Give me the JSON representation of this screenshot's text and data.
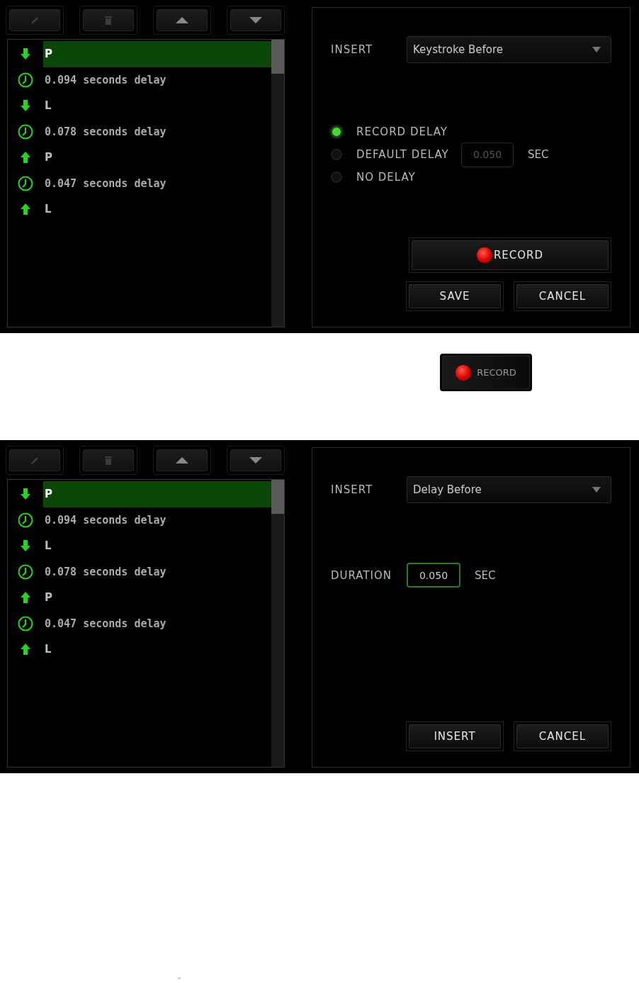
{
  "screens": [
    {
      "toolbar": [
        {
          "kind": "edit",
          "disabled": true
        },
        {
          "kind": "delete",
          "disabled": true
        },
        {
          "kind": "up",
          "disabled": false
        },
        {
          "kind": "down",
          "disabled": false
        }
      ],
      "macro_list": [
        {
          "kind": "key_down",
          "label": "P",
          "selected": true
        },
        {
          "kind": "delay",
          "label": "0.094 seconds delay",
          "selected": false
        },
        {
          "kind": "key_down",
          "label": "L",
          "selected": false
        },
        {
          "kind": "delay",
          "label": "0.078 seconds delay",
          "selected": false
        },
        {
          "kind": "key_up",
          "label": "P",
          "selected": false
        },
        {
          "kind": "delay",
          "label": "0.047 seconds delay",
          "selected": false
        },
        {
          "kind": "key_up",
          "label": "L",
          "selected": false
        }
      ],
      "panel": {
        "insert_label": "INSERT",
        "insert_value": "Keystroke Before",
        "delay_options": [
          {
            "label": "RECORD DELAY",
            "selected": true
          },
          {
            "label": "DEFAULT DELAY",
            "selected": false,
            "value": "0.050",
            "unit": "SEC"
          },
          {
            "label": "NO DELAY",
            "selected": false
          }
        ],
        "record_button": "RECORD",
        "buttons": [
          "SAVE",
          "CANCEL"
        ]
      }
    },
    {
      "toolbar": [
        {
          "kind": "edit",
          "disabled": true
        },
        {
          "kind": "delete",
          "disabled": true
        },
        {
          "kind": "up",
          "disabled": false
        },
        {
          "kind": "down",
          "disabled": false
        }
      ],
      "macro_list": [
        {
          "kind": "key_down",
          "label": "P",
          "selected": true
        },
        {
          "kind": "delay",
          "label": "0.094 seconds delay",
          "selected": false
        },
        {
          "kind": "key_down",
          "label": "L",
          "selected": false
        },
        {
          "kind": "delay",
          "label": "0.078 seconds delay",
          "selected": false
        },
        {
          "kind": "key_up",
          "label": "P",
          "selected": false
        },
        {
          "kind": "delay",
          "label": "0.047 seconds delay",
          "selected": false
        },
        {
          "kind": "key_up",
          "label": "L",
          "selected": false
        }
      ],
      "panel": {
        "insert_label": "INSERT",
        "insert_value": "Delay Before",
        "duration": {
          "label": "DURATION",
          "value": "0.050",
          "unit": "SEC"
        },
        "buttons": [
          "INSERT",
          "CANCEL"
        ]
      }
    }
  ],
  "standalone_record_button": "RECORD",
  "trademark": "™"
}
